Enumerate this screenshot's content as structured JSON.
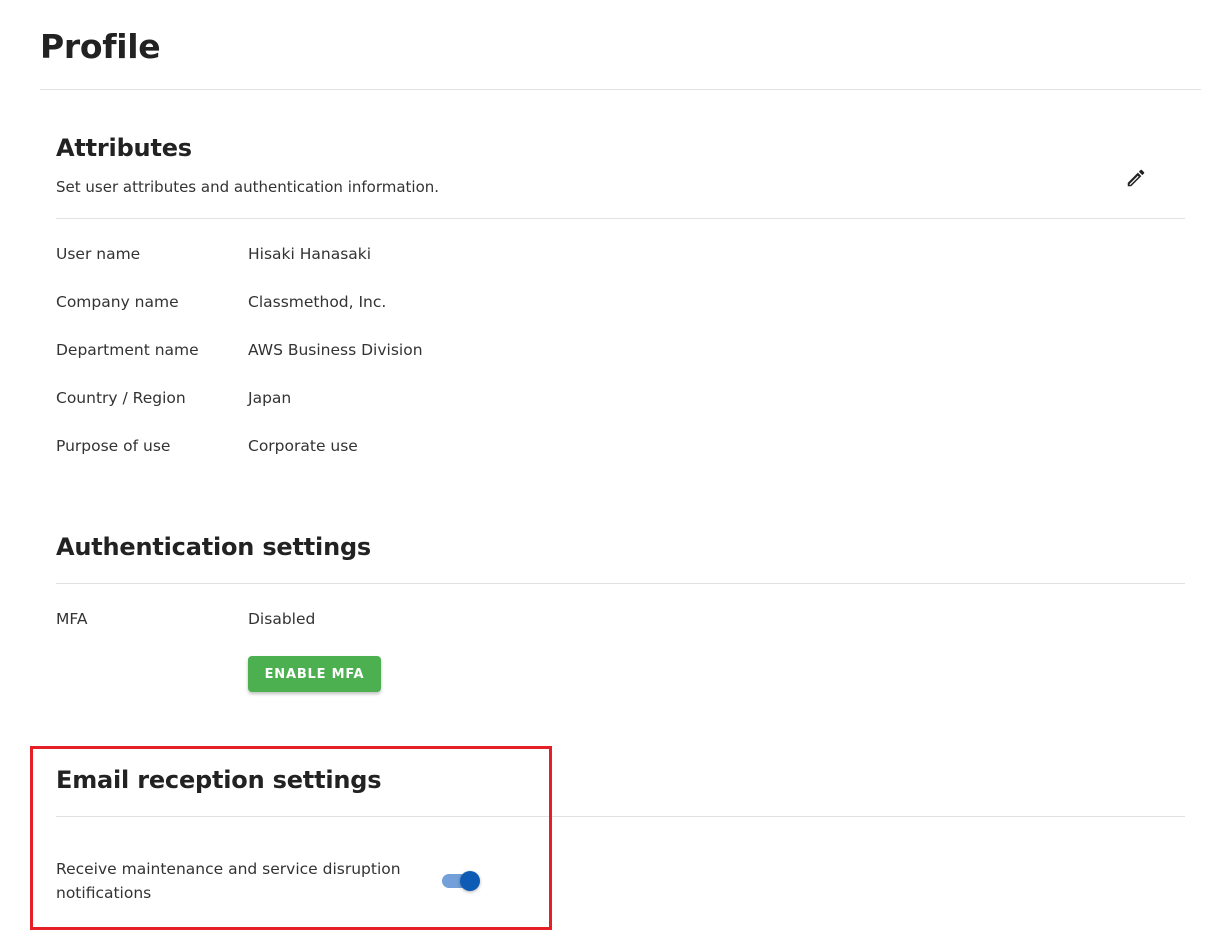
{
  "page": {
    "title": "Profile"
  },
  "attributes": {
    "heading": "Attributes",
    "description": "Set user attributes and authentication information.",
    "edit_icon": "pencil-icon",
    "rows": [
      {
        "label": "User name",
        "value": "Hisaki Hanasaki"
      },
      {
        "label": "Company name",
        "value": "Classmethod, Inc."
      },
      {
        "label": "Department name",
        "value": "AWS Business Division"
      },
      {
        "label": "Country / Region",
        "value": "Japan"
      },
      {
        "label": "Purpose of use",
        "value": "Corporate use"
      }
    ]
  },
  "authentication": {
    "heading": "Authentication settings",
    "mfa_label": "MFA",
    "mfa_value": "Disabled",
    "enable_button_label": "ENABLE MFA"
  },
  "email_reception": {
    "heading": "Email reception settings",
    "notification_label": "Receive maintenance and service disruption notifications",
    "notification_enabled": true
  },
  "colors": {
    "primary_button": "#4caf50",
    "toggle_on": "#0d5bb5",
    "highlight_border": "#e51f26",
    "divider": "#e2e2e2"
  }
}
